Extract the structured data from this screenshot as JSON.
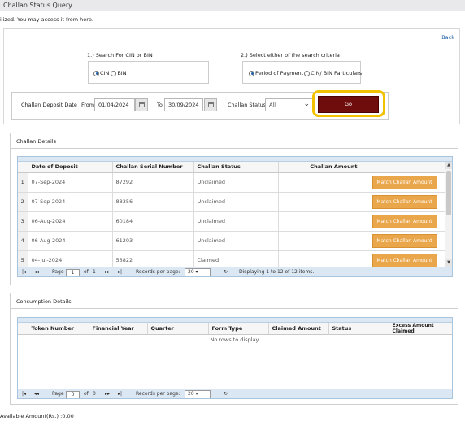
{
  "page": {
    "title": "Challan Status Query",
    "info": "ilized. You may access it from here.",
    "back": "Back"
  },
  "criteria": {
    "search_label": "1.) Search For CIN or BIN",
    "cin": "CIN",
    "bin": "BIN",
    "select_label": "2.) Select either of the search criteria",
    "period": "Period of Payment",
    "particulars": "CIN/ BIN Particulars"
  },
  "filter": {
    "deposit_date_label": "Challan Deposit Date",
    "from_label": "From",
    "from_value": "01/04/2024",
    "to_label": "To",
    "to_value": "30/09/2024",
    "status_label": "Challan Status",
    "status_value": "All",
    "go": "Go"
  },
  "challan": {
    "title": "Challan Details",
    "columns": [
      "Date of Deposit",
      "Challan Serial Number",
      "Challan Status",
      "Challan Amount"
    ],
    "match_label": "Match Challan Amount",
    "rows": [
      {
        "n": "1",
        "date": "07-Sep-2024",
        "serial": "87292",
        "status": "Unclaimed",
        "amount": ""
      },
      {
        "n": "2",
        "date": "07-Sep-2024",
        "serial": "88356",
        "status": "Unclaimed",
        "amount": ""
      },
      {
        "n": "3",
        "date": "06-Aug-2024",
        "serial": "60184",
        "status": "Unclaimed",
        "amount": ""
      },
      {
        "n": "4",
        "date": "06-Aug-2024",
        "serial": "61203",
        "status": "Unclaimed",
        "amount": ""
      },
      {
        "n": "5",
        "date": "04-Jul-2024",
        "serial": "53822",
        "status": "Claimed",
        "amount": ""
      }
    ],
    "pager": {
      "first": "|◂",
      "prev": "◂◂",
      "page_label": "Page",
      "page": "1",
      "of_label": "of",
      "total": "1",
      "next": "▸▸",
      "last": "▸|",
      "rpp_label": "Records per page:",
      "rpp": "20",
      "refresh": "↻",
      "display": "Displaying 1 to 12 of 12 items."
    }
  },
  "consumption": {
    "title": "Consumption Details",
    "columns": [
      "Token Number",
      "Financial Year",
      "Quarter",
      "Form Type",
      "Claimed Amount",
      "Status",
      "Excess Amount Claimed"
    ],
    "no_rows": "No rows to display.",
    "pager": {
      "first": "|◂",
      "prev": "◂◂",
      "page_label": "Page",
      "page": "0",
      "of_label": "of",
      "total": "0",
      "next": "▸▸",
      "last": "▸|",
      "rpp_label": "Records per page:",
      "rpp": "20",
      "refresh": "↻"
    }
  },
  "available": "Available Amount(Rs.) :0.00"
}
